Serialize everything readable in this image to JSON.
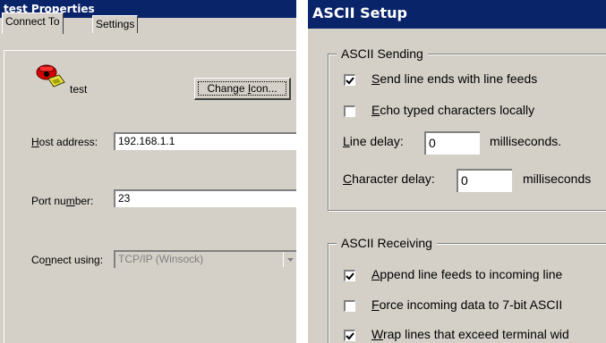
{
  "left_window": {
    "title": "test Properties",
    "tabs": [
      {
        "label": "Connect To",
        "active": true
      },
      {
        "label": "Settings",
        "active": false
      }
    ],
    "connection_name": "test",
    "change_icon_button": {
      "pre": "Change ",
      "mnemonic": "I",
      "post": "con..."
    },
    "host_address": {
      "pre": "",
      "mnemonic": "H",
      "post": "ost address:",
      "value": "192.168.1.1"
    },
    "port_number": {
      "pre": "Port nu",
      "mnemonic": "m",
      "post": "ber:",
      "value": "23"
    },
    "connect_using": {
      "pre": "Co",
      "mnemonic": "n",
      "post": "nect using:",
      "value": "TCP/IP (Winsock)"
    },
    "icon": "phone-connection-icon"
  },
  "right_window": {
    "title": "ASCII Setup",
    "sending_group": "ASCII Sending",
    "receiving_group": "ASCII Receiving",
    "sending": [
      {
        "pre": "",
        "mnemonic": "S",
        "post": "end line ends with line feeds",
        "checked": true
      },
      {
        "pre": "",
        "mnemonic": "E",
        "post": "cho typed characters locally",
        "checked": false
      }
    ],
    "line_delay": {
      "pre": "",
      "mnemonic": "L",
      "post": "ine delay:",
      "value": "0",
      "unit": "milliseconds."
    },
    "character_delay": {
      "pre": "",
      "mnemonic": "C",
      "post": "haracter delay:",
      "value": "0",
      "unit": "milliseconds"
    },
    "receiving": [
      {
        "pre": "",
        "mnemonic": "A",
        "post": "ppend line feeds to incoming line",
        "checked": true
      },
      {
        "pre": "",
        "mnemonic": "F",
        "post": "orce incoming data to 7-bit ASCII",
        "checked": false
      },
      {
        "pre": "",
        "mnemonic": "W",
        "post": "rap lines that exceed terminal wid",
        "checked": true
      }
    ]
  }
}
